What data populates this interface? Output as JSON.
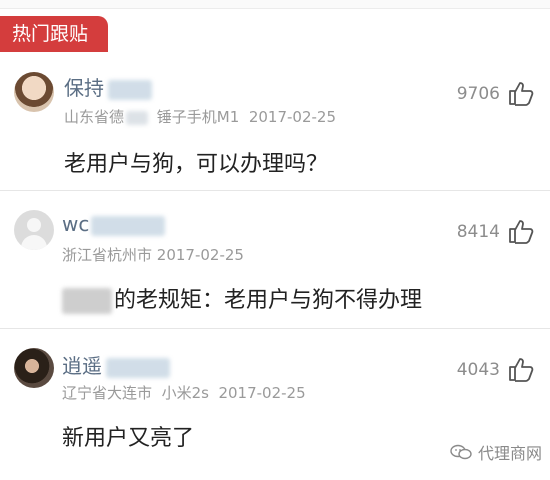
{
  "section": {
    "tag": "热门跟贴"
  },
  "comments": [
    {
      "user": "保持",
      "location": "山东省德",
      "device": "锤子手机M1",
      "date": "2017-02-25",
      "likes": "9706",
      "text": "老用户与狗，可以办理吗？"
    },
    {
      "user": "wc",
      "location": "浙江省杭州市",
      "device": "",
      "date": "2017-02-25",
      "likes": "8414",
      "text": "的老规矩：老用户与狗不得办理"
    },
    {
      "user": "逍遥",
      "location": "辽宁省大连市",
      "device": "小米2s",
      "date": "2017-02-25",
      "likes": "4043",
      "text": "新用户又亮了"
    }
  ],
  "watermark": {
    "text": "代理商网",
    "icon": "wechat-icon"
  },
  "colors": {
    "tag_bg": "#d43d3d",
    "username": "#5b6e84",
    "meta": "#9a9a9a"
  }
}
